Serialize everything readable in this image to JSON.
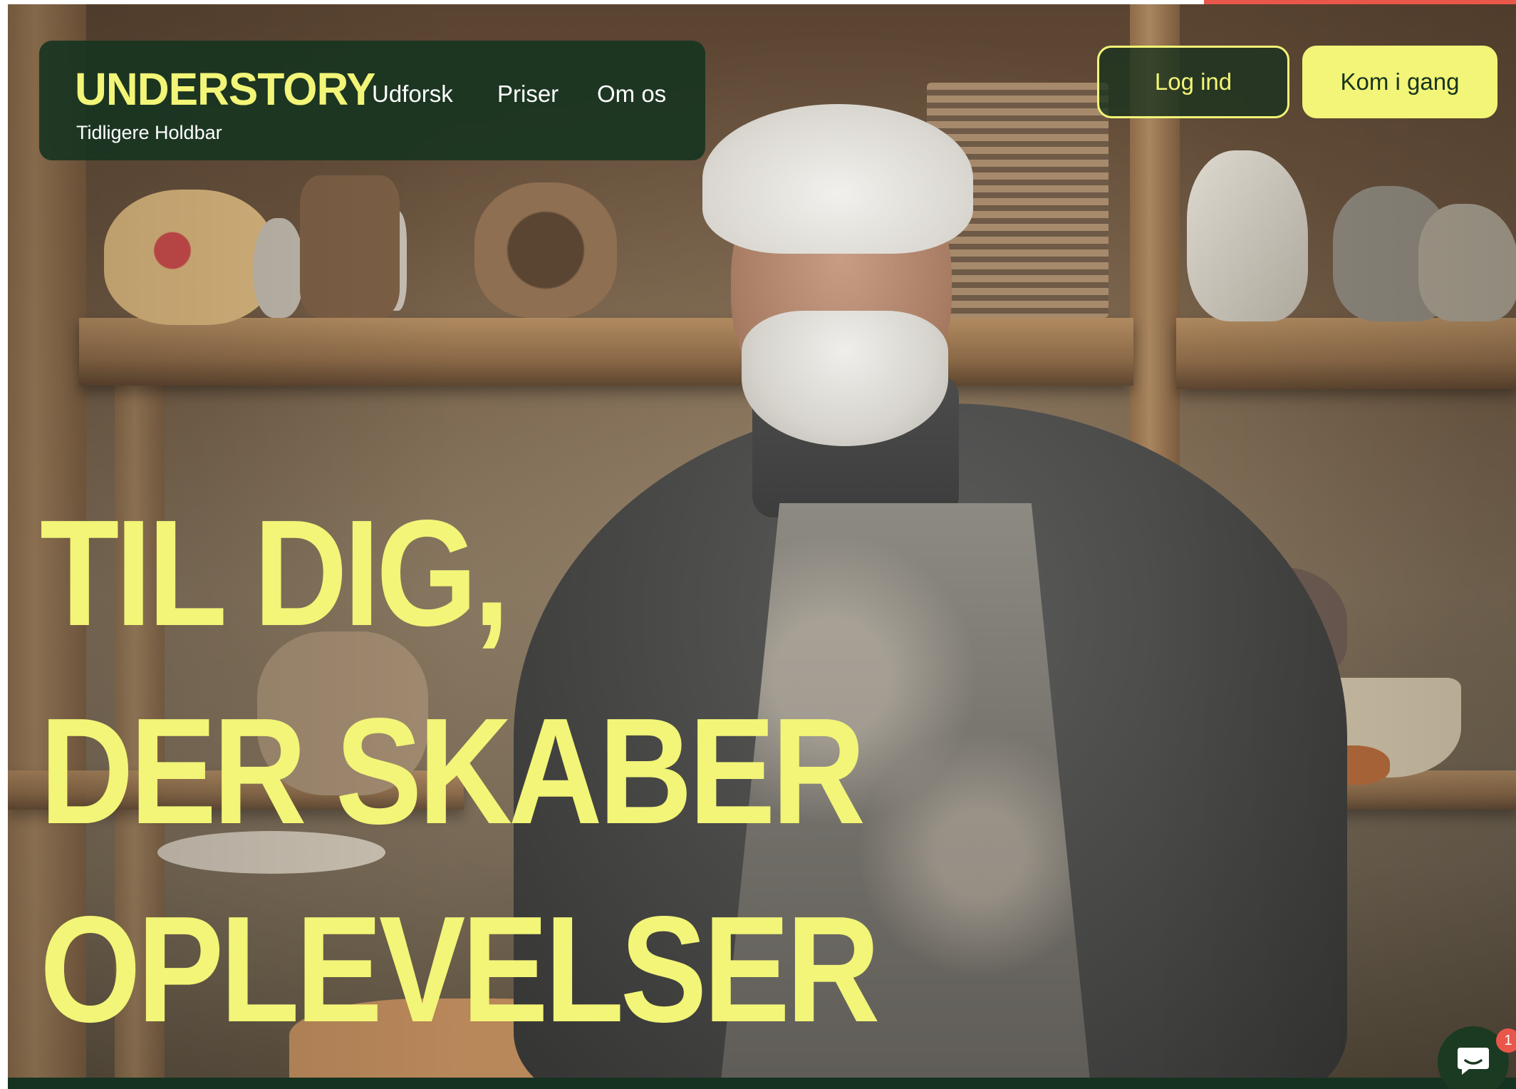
{
  "header": {
    "brand": {
      "name": "UNDERSTORY",
      "subtitle": "Tidligere Holdbar"
    },
    "nav": [
      {
        "label": "Udforsk"
      },
      {
        "label": "Priser"
      },
      {
        "label": "Om os"
      }
    ],
    "login_label": "Log ind",
    "cta_label": "Kom i gang"
  },
  "hero": {
    "headline_lines": [
      "TIL DIG,",
      "DER SKABER",
      "OPLEVELSER"
    ]
  },
  "chat": {
    "icon": "chat-bubble-icon",
    "badge_count": "1"
  },
  "colors": {
    "brand_yellow": "#f2f577",
    "brand_green": "#163321",
    "accent_red": "#e9574b"
  }
}
